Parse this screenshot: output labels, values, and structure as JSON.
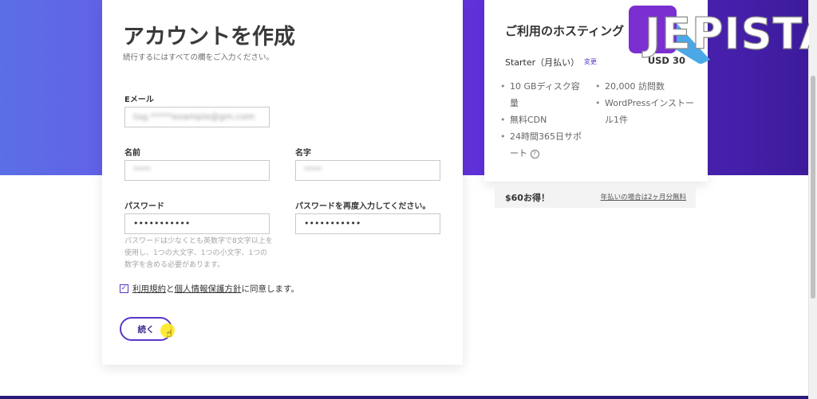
{
  "form": {
    "title": "アカウントを作成",
    "subtitle": "続行するにはすべての欄をご入力ください。",
    "email_label": "Eメール",
    "email_value": "tog.*****example@gm.com",
    "first_name_label": "名前",
    "first_name_value": "****",
    "last_name_label": "名字",
    "last_name_value": "****",
    "password_label": "パスワード",
    "password_value": "•••••••••••",
    "password_confirm_label": "パスワードを再度入力してください。",
    "password_confirm_value": "•••••••••••",
    "password_hint": "パスワードは少なくとも英数字で8文字以上を使用し、1つの大文字、1つの小文字、1つの数字を含める必要があります。",
    "checkbox_mark": "✓",
    "agree_terms": "利用規約",
    "agree_and": "と",
    "agree_privacy": "個人情報保護方針",
    "agree_suffix": "に同意します。",
    "continue_label": "続く"
  },
  "plan": {
    "title": "ご利用のホスティング",
    "name": "Starter（月払い）",
    "change_label": "変更",
    "price": "USD 30",
    "features_left": [
      {
        "bullet": "•",
        "text": "10 GBディスク容量"
      },
      {
        "bullet": "•",
        "text": "無料CDN"
      },
      {
        "bullet": "•",
        "text": "24時間365日サポート"
      }
    ],
    "features_right": [
      {
        "bullet": "•",
        "text": "20,000 訪問数"
      },
      {
        "bullet": "•",
        "text": "WordPressインストール1件"
      }
    ],
    "info_glyph": "?"
  },
  "savings": {
    "amount": "$60お得！",
    "note": "年払いの場合は2ヶ月分無料"
  },
  "logo": {
    "text": "JEPISTA"
  },
  "colors": {
    "accent": "#5b36c9",
    "hero_start": "#5b6fe6",
    "hero_end": "#3c1a9a"
  }
}
